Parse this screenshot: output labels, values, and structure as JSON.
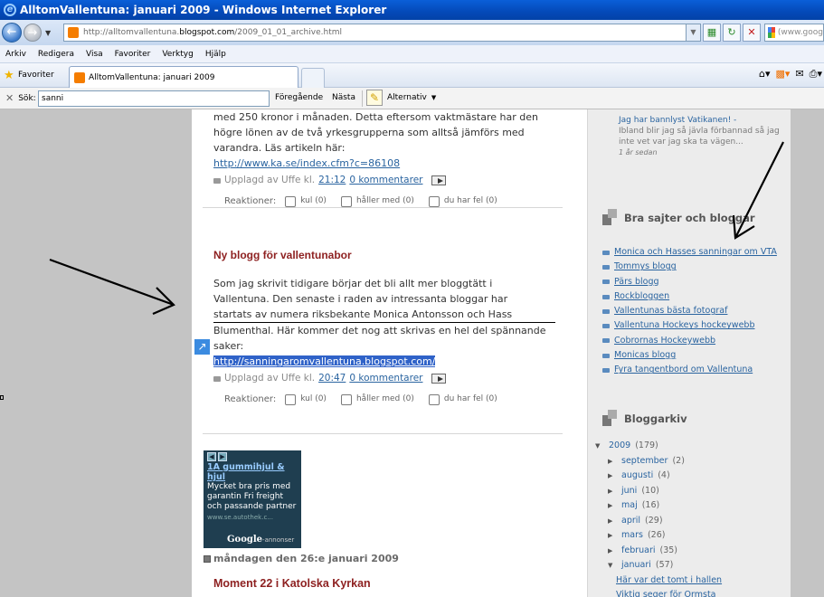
{
  "window": {
    "title": "AlltomVallentuna: januari 2009 - Windows Internet Explorer"
  },
  "address": {
    "url_prefix": "http://alltomvallentuna.",
    "url_domain": "blogspot.com",
    "url_suffix": "/2009_01_01_archive.html",
    "search_placeholder": "(www.goog"
  },
  "menu": [
    "Arkiv",
    "Redigera",
    "Visa",
    "Favoriter",
    "Verktyg",
    "Hjälp"
  ],
  "favorites": {
    "label": "Favoriter",
    "tab_title": "AlltomVallentuna: januari 2009"
  },
  "find": {
    "label": "Sök:",
    "value": "sanni",
    "prev": "Föregående",
    "next": "Nästa",
    "options": "Alternativ"
  },
  "post1": {
    "lines": [
      "med 250 kronor i månaden. Detta eftersom vaktmästare har den",
      "högre lönen av de två yrkesgrupperna som alltså jämförs med",
      "varandra. Läs artikeln här:"
    ],
    "link": "http://www.ka.se/index.cfm?c=86108",
    "meta_prefix": "Upplagd av Uffe kl.",
    "time": "21:12",
    "comments": "0 kommentarer"
  },
  "reactions": {
    "label": "Reaktioner:",
    "options": [
      "kul (0)",
      "håller med (0)",
      "du har fel (0)"
    ]
  },
  "post2": {
    "title": "Ny blogg för vallentunabor",
    "lines": [
      "Som jag skrivit tidigare börjar det bli allt mer bloggtätt i",
      "Vallentuna. Den senaste i raden av intressanta bloggar har",
      "startats av numera riksbekante Monica Antonsson och Hass",
      "Blumenthal. Här kommer det nog att skrivas en hel del spännande",
      "saker:"
    ],
    "link": "http://sanningaromvallentuna.blogspot.com/",
    "meta_prefix": "Upplagd av Uffe kl.",
    "time": "20:47",
    "comments": "0 kommentarer"
  },
  "ad": {
    "headline": "1A gummihjul & hjul",
    "body": "Mycket bra pris med garantin Fri freight och passande partner",
    "url": "www.se.autothek.c...",
    "google": "Google",
    "google_suffix": "-annonser"
  },
  "date_header": "måndagen den 26:e januari 2009",
  "post3": {
    "title": "Moment 22 i Katolska Kyrkan"
  },
  "sidebar": {
    "snippet_link": "Jag har bannlyst Vatikanen! -",
    "snippet_text": "Ibland blir jag så jävla förbannad så jag inte vet var jag ska ta vägen...",
    "snippet_ago": "1 år sedan",
    "links_title": "Bra sajter och bloggar",
    "links": [
      "Monica och Hasses sanningar om VTA",
      "Tommys blogg",
      "Pärs blogg",
      "Rockbloggen",
      "Vallentunas bästa fotograf",
      "Vallentuna Hockeys hockeywebb",
      "Cobrornas Hockeywebb",
      "Monicas blogg",
      "Fyra tangentbord om Vallentuna"
    ],
    "archive_title": "Bloggarkiv",
    "archive_year": "2009",
    "archive_year_count": "(179)",
    "months": [
      {
        "name": "september",
        "count": "(2)"
      },
      {
        "name": "augusti",
        "count": "(4)"
      },
      {
        "name": "juni",
        "count": "(10)"
      },
      {
        "name": "maj",
        "count": "(16)"
      },
      {
        "name": "april",
        "count": "(29)"
      },
      {
        "name": "mars",
        "count": "(26)"
      },
      {
        "name": "februari",
        "count": "(35)"
      }
    ],
    "open_month": {
      "name": "januari",
      "count": "(57)"
    },
    "open_posts": [
      "Här var det tomt i hallen",
      "Viktig seger för Ormsta"
    ]
  }
}
